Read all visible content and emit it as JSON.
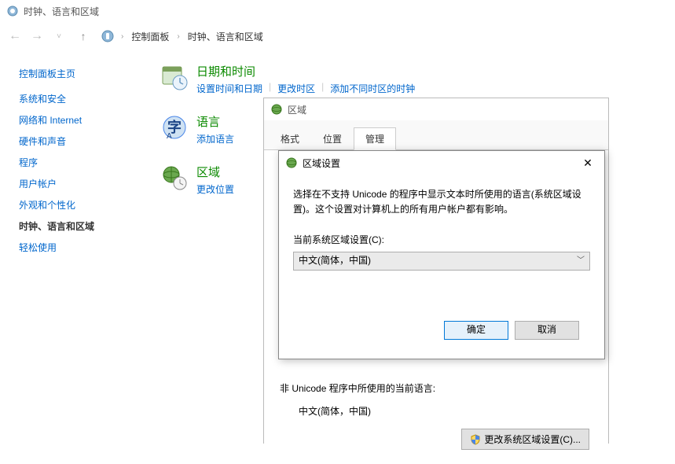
{
  "titlebar": {
    "text": "时钟、语言和区域"
  },
  "breadcrumb": {
    "items": [
      "控制面板",
      "时钟、语言和区域"
    ]
  },
  "sidebar": {
    "head": "控制面板主页",
    "items": [
      "系统和安全",
      "网络和 Internet",
      "硬件和声音",
      "程序",
      "用户帐户",
      "外观和个性化",
      "时钟、语言和区域",
      "轻松使用"
    ],
    "active_index": 6
  },
  "sections": [
    {
      "title": "日期和时间",
      "links": [
        "设置时间和日期",
        "更改时区",
        "添加不同时区的时钟"
      ]
    },
    {
      "title": "语言",
      "links": [
        "添加语言"
      ]
    },
    {
      "title": "区域",
      "links": [
        "更改位置"
      ]
    }
  ],
  "region_window": {
    "title": "区域",
    "tabs": [
      "格式",
      "位置",
      "管理"
    ],
    "active_tab": 2,
    "non_unicode_label": "非 Unicode 程序中所使用的当前语言:",
    "non_unicode_value": "中文(简体，中国)",
    "change_button": "更改系统区域设置(C)..."
  },
  "modal": {
    "title": "区域设置",
    "description": "选择在不支持 Unicode 的程序中显示文本时所使用的语言(系统区域设置)。这个设置对计算机上的所有用户帐户都有影响。",
    "field_label": "当前系统区域设置(C):",
    "selected_value": "中文(简体，中国)",
    "ok": "确定",
    "cancel": "取消"
  }
}
